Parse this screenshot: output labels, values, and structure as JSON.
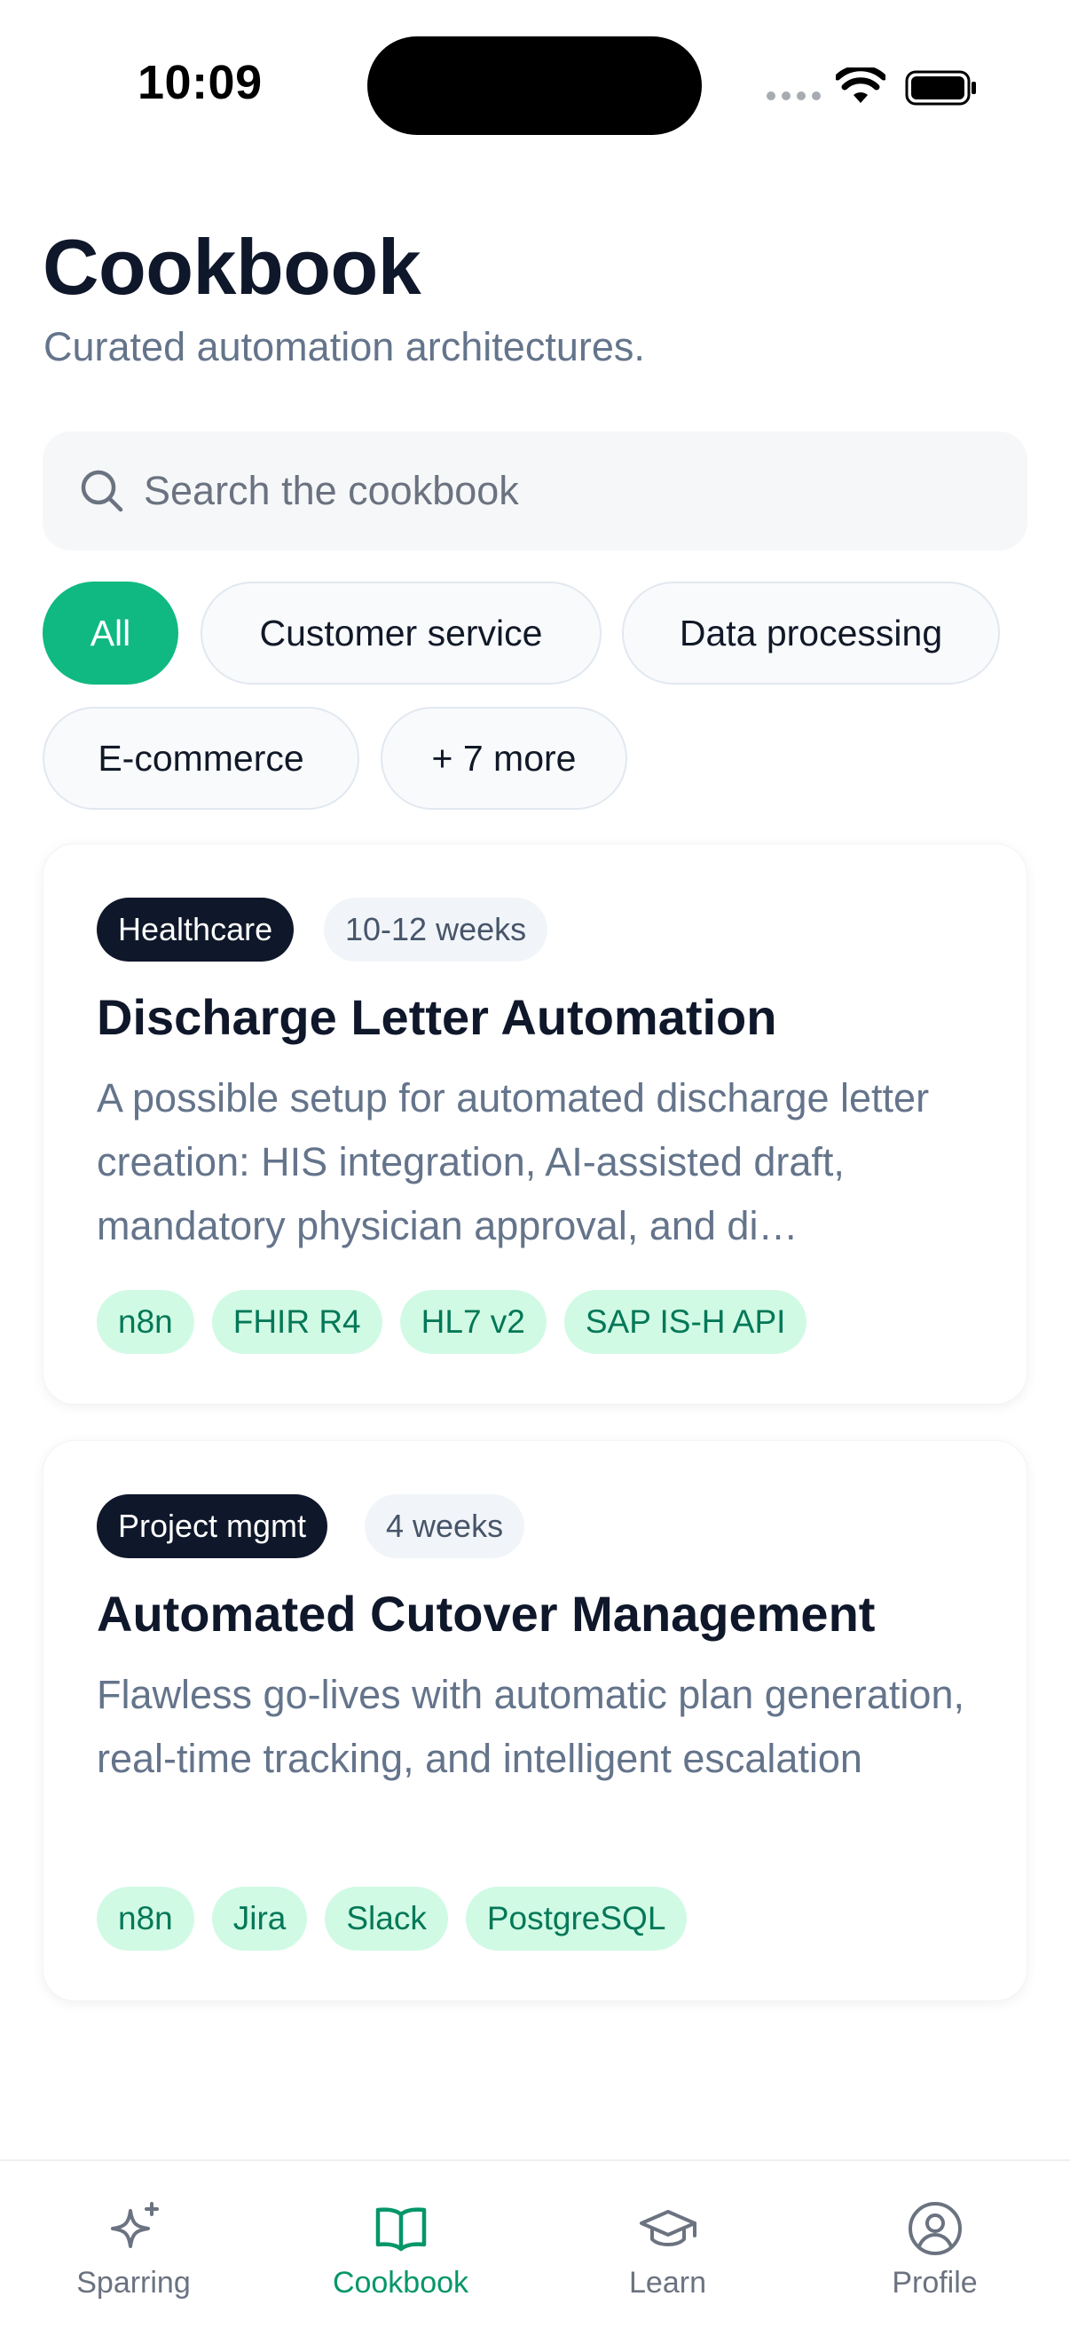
{
  "status_bar": {
    "time": "10:09"
  },
  "header": {
    "title": "Cookbook",
    "subtitle": "Curated automation architectures."
  },
  "search": {
    "placeholder": "Search the cookbook",
    "value": ""
  },
  "filters": [
    {
      "label": "All",
      "active": true
    },
    {
      "label": "Customer service",
      "active": false
    },
    {
      "label": "Data processing",
      "active": false
    },
    {
      "label": "E-commerce",
      "active": false
    },
    {
      "label": "+ 7 more",
      "active": false
    }
  ],
  "cards": [
    {
      "category": "Healthcare",
      "duration": "10-12 weeks",
      "title": "Discharge Letter Automation",
      "description": "A possible setup for automated discharge letter creation: HIS integration, AI-assisted draft, mandatory physician approval, and di…",
      "tags": [
        "n8n",
        "FHIR R4",
        "HL7 v2",
        "SAP IS-H API"
      ]
    },
    {
      "category": "Project mgmt",
      "duration": "4 weeks",
      "title": "Automated Cutover Management",
      "description": "Flawless go-lives with automatic plan generation, real-time tracking, and intelligent escalation",
      "tags": [
        "n8n",
        "Jira",
        "Slack",
        "PostgreSQL"
      ]
    }
  ],
  "tab_bar": [
    {
      "label": "Sparring",
      "icon": "sparkles-icon",
      "active": false
    },
    {
      "label": "Cookbook",
      "icon": "book-open-icon",
      "active": true
    },
    {
      "label": "Learn",
      "icon": "graduation-cap-icon",
      "active": false
    },
    {
      "label": "Profile",
      "icon": "user-circle-icon",
      "active": false
    }
  ],
  "colors": {
    "accent": "#10b981",
    "dark_badge": "#0f172a",
    "tag_bg": "#d1fae5",
    "tag_text": "#047857"
  }
}
